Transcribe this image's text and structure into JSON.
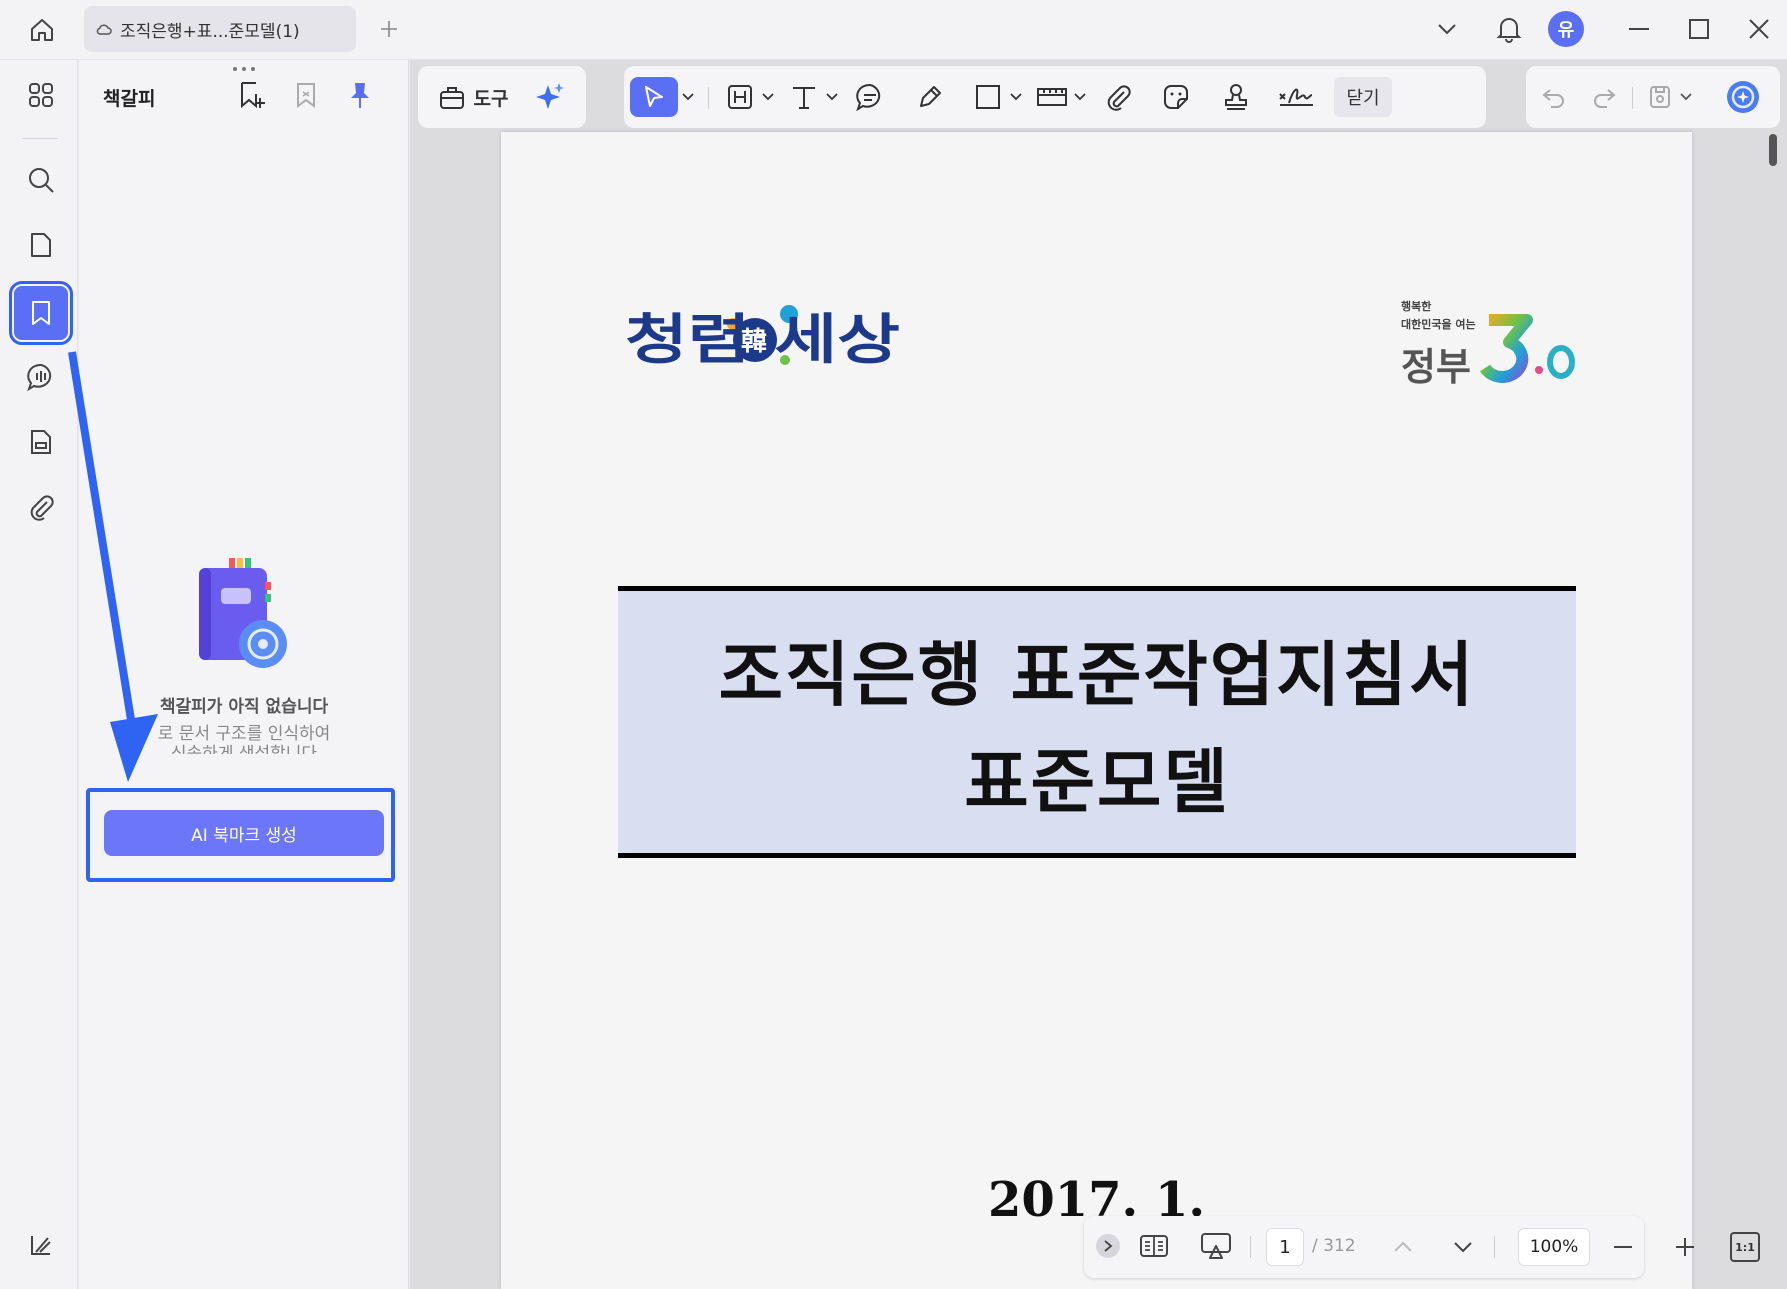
{
  "window": {
    "tab_title": "조직은행+표...준모델(1)",
    "user_initial": "유"
  },
  "sidebar": {
    "panel_title": "책갈피",
    "empty_title": "책갈피가 아직 없습니다",
    "empty_desc_line1": "로 문서 구조를 인식하여",
    "empty_desc_line2": "신속하게 생성합니다",
    "ai_button_label": "AI 북마크 생성"
  },
  "toolbar": {
    "tools_label": "도구",
    "close_label": "닫기"
  },
  "document": {
    "logo_left_text": "청렴韓세상",
    "logo_right_small1": "행복한",
    "logo_right_small2": "대한민국을 여는",
    "logo_right_main": "정부",
    "logo_right_num": "3.0",
    "title_line1": "조직은행 표준작업지침서",
    "title_line2": "표준모델",
    "date": "2017.  1."
  },
  "bottombar": {
    "page_current": "1",
    "page_total": "/ 312",
    "zoom": "100%",
    "fit_label": "1:1"
  },
  "colors": {
    "accent": "#5b6ff5",
    "annotation_blue": "#2f63f2",
    "title_box_bg": "#d9def0"
  }
}
